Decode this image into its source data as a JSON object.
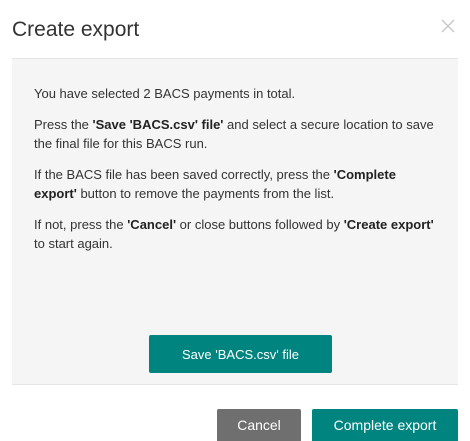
{
  "dialog": {
    "title": "Create export",
    "close_icon": "close-icon"
  },
  "body": {
    "p1": "You have selected 2 BACS payments in total.",
    "p2_pre": "Press the ",
    "p2_bold": "'Save 'BACS.csv' file'",
    "p2_post": " and select a secure location to save the final file for this BACS run.",
    "p3_pre": "If the BACS file has been saved correctly, press the ",
    "p3_bold": "'Complete export'",
    "p3_post": " button to remove the payments from the list.",
    "p4_pre": "If not, press the ",
    "p4_bold1": "'Cancel'",
    "p4_mid": " or close buttons followed by ",
    "p4_bold2": "'Create export'",
    "p4_post": " to start again.",
    "save_label": "Save 'BACS.csv' file"
  },
  "footer": {
    "cancel_label": "Cancel",
    "complete_label": "Complete export"
  },
  "colors": {
    "accent": "#00847f",
    "cancel": "#6f6f6f",
    "panel": "#f5f5f5"
  }
}
